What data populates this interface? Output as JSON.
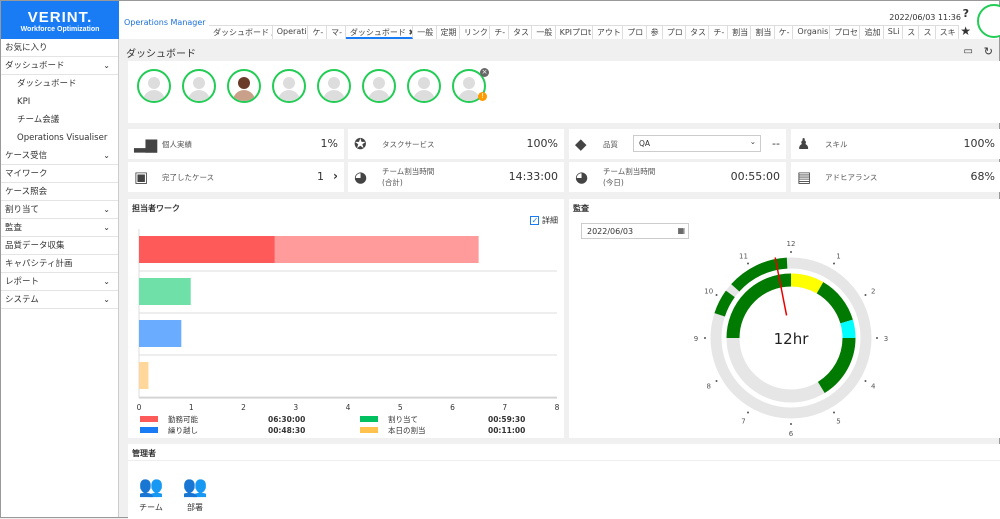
{
  "brand": {
    "name": "VERINT.",
    "sub": "Workforce Optimization"
  },
  "app_name": "Operations Manager",
  "header": {
    "datetime": "2022/06/03 11:36",
    "help": "?",
    "star": "★"
  },
  "tabs": [
    "ダッシュボード /",
    "Operati",
    "ケ-",
    "マ-",
    "ダッシュボード",
    "一般",
    "定期",
    "リンク",
    "チ-",
    "タス",
    "一般",
    "KPIプロt",
    "アウト",
    "プロ",
    "参",
    "プロ",
    "タス",
    "チ-",
    "割当",
    "割当",
    "ケ-",
    "Organis",
    "プロセ",
    "追加",
    "SLi",
    "ス",
    "ス",
    "スキ"
  ],
  "active_tab_index": 4,
  "sidebar": [
    {
      "label": "お気に入り"
    },
    {
      "label": "ダッシュボード",
      "expandable": true
    },
    {
      "label": "ダッシュボード",
      "sub": true
    },
    {
      "label": "KPI",
      "sub": true
    },
    {
      "label": "チーム会議",
      "sub": true
    },
    {
      "label": "Operations Visualiser",
      "sub": true
    },
    {
      "label": "ケース受信",
      "expandable": true
    },
    {
      "label": "マイワーク"
    },
    {
      "label": "ケース照会"
    },
    {
      "label": "割り当て",
      "expandable": true
    },
    {
      "label": "監査",
      "expandable": true
    },
    {
      "label": "品質データ収集"
    },
    {
      "label": "キャパシティ計画"
    },
    {
      "label": "レポート",
      "expandable": true
    },
    {
      "label": "システム",
      "expandable": true
    }
  ],
  "page_title": "ダッシュボード",
  "stats": [
    {
      "label": "個人実績",
      "value": "1%",
      "icon": "bar-chart-up-icon"
    },
    {
      "label": "タスクサービス",
      "value": "100%",
      "icon": "award-icon"
    },
    {
      "label": "品質",
      "select": "QA",
      "value": "--",
      "icon": "diamond-icon"
    },
    {
      "label": "スキル",
      "value": "100%",
      "icon": "skill-people-icon"
    },
    {
      "label": "完了したケース",
      "value": "1",
      "icon": "completed-cases-icon"
    },
    {
      "label": "チーム割当時間",
      "label2": "(合計)",
      "value": "14:33:00",
      "icon": "pie-icon"
    },
    {
      "label": "チーム割当時間",
      "label2": "(今日)",
      "value": "00:55:00",
      "icon": "pie-icon"
    },
    {
      "label": "アドヒアランス",
      "value": "68%",
      "icon": "adherence-icon"
    }
  ],
  "work_panel": {
    "title": "担当者ワーク",
    "detail_label": "詳細",
    "detail_checked": true
  },
  "chart_data": {
    "type": "bar",
    "orientation": "horizontal",
    "xlim": [
      0,
      8
    ],
    "xticks": [
      0,
      1,
      2,
      3,
      4,
      5,
      6,
      7,
      8
    ],
    "bars": [
      {
        "segments": [
          {
            "value": 2.6,
            "color": "#ff5a5a"
          },
          {
            "value": 3.9,
            "color": "#ff9b9b"
          }
        ]
      },
      {
        "segments": [
          {
            "value": 0.99,
            "color": "#6ee0a8"
          }
        ]
      },
      {
        "segments": [
          {
            "value": 0.81,
            "color": "#6aacff"
          }
        ]
      },
      {
        "segments": [
          {
            "value": 0.18,
            "color": "#ffd79a"
          }
        ]
      }
    ],
    "legend": [
      {
        "name": "勤務可能",
        "value": "06:30:00",
        "color": "#ff5a5a"
      },
      {
        "name": "割り当て",
        "value": "00:59:30",
        "color": "#00c060"
      },
      {
        "name": "繰り越し",
        "value": "00:48:30",
        "color": "#1a7cf5"
      },
      {
        "name": "本日の割当",
        "value": "00:11:00",
        "color": "#ffc34d"
      }
    ]
  },
  "audit_panel": {
    "title": "監査",
    "date": "2022/06/03",
    "center_label": "12hr",
    "hours": [
      "12",
      "1",
      "2",
      "3",
      "4",
      "5",
      "6",
      "7",
      "8",
      "9",
      "10",
      "11"
    ],
    "inner_segments": [
      {
        "from": 9,
        "to": 12,
        "color": "#007a00"
      },
      {
        "from": 12,
        "to": 13,
        "color": "#ffff00"
      },
      {
        "from": 13,
        "to": 14.45,
        "color": "#007a00"
      },
      {
        "from": 14.45,
        "to": 15,
        "color": "#00ffff"
      },
      {
        "from": 15,
        "to": 16.95,
        "color": "#007a00"
      }
    ],
    "outer_segments": [
      {
        "from": 9.6,
        "to": 10.2,
        "color": "#007a00"
      },
      {
        "from": 10.4,
        "to": 11.9,
        "color": "#007a00"
      }
    ],
    "current_hour": 11.63
  },
  "manager_panel": {
    "title": "管理者",
    "items": [
      {
        "label": "チーム"
      },
      {
        "label": "部署"
      }
    ]
  }
}
